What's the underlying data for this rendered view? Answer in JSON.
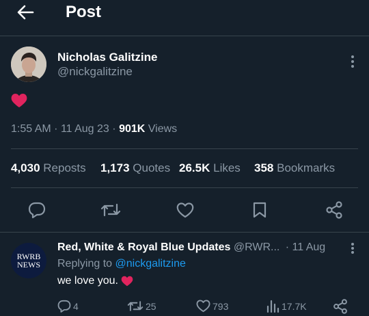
{
  "header": {
    "title": "Post"
  },
  "post": {
    "author_name": "Nicholas Galitzine",
    "author_handle": "@nickgalitzine",
    "body_emoji": "❤️",
    "time": "1:55 AM",
    "date": "11 Aug 23",
    "views_count": "901K",
    "views_label": "Views",
    "sep": "·"
  },
  "stats": {
    "reposts_count": "4,030",
    "reposts_label": "Reposts",
    "quotes_count": "1,173",
    "quotes_label": "Quotes",
    "likes_count": "26.5K",
    "likes_label": "Likes",
    "bookmarks_count": "358",
    "bookmarks_label": "Bookmarks"
  },
  "actions": [
    "reply-icon",
    "repost-icon",
    "like-icon",
    "bookmark-icon",
    "share-icon"
  ],
  "reply": {
    "avatar_line1": "RWRB",
    "avatar_line2": "NEWS",
    "author_name": "Red, White & Royal Blue Updates",
    "author_handle": "@RWR...",
    "date": "· 11 Aug",
    "replying_to_label": "Replying to",
    "replying_to_handle": "@nickgalitzine",
    "text": "we love you.",
    "text_emoji": "❤️",
    "replies": "4",
    "reposts": "25",
    "likes": "793",
    "views": "17.7K"
  },
  "colors": {
    "background": "#15202b",
    "muted": "#8b98a5",
    "accent": "#1d9bf0",
    "heart": "#f91880",
    "divider": "#38444d"
  }
}
